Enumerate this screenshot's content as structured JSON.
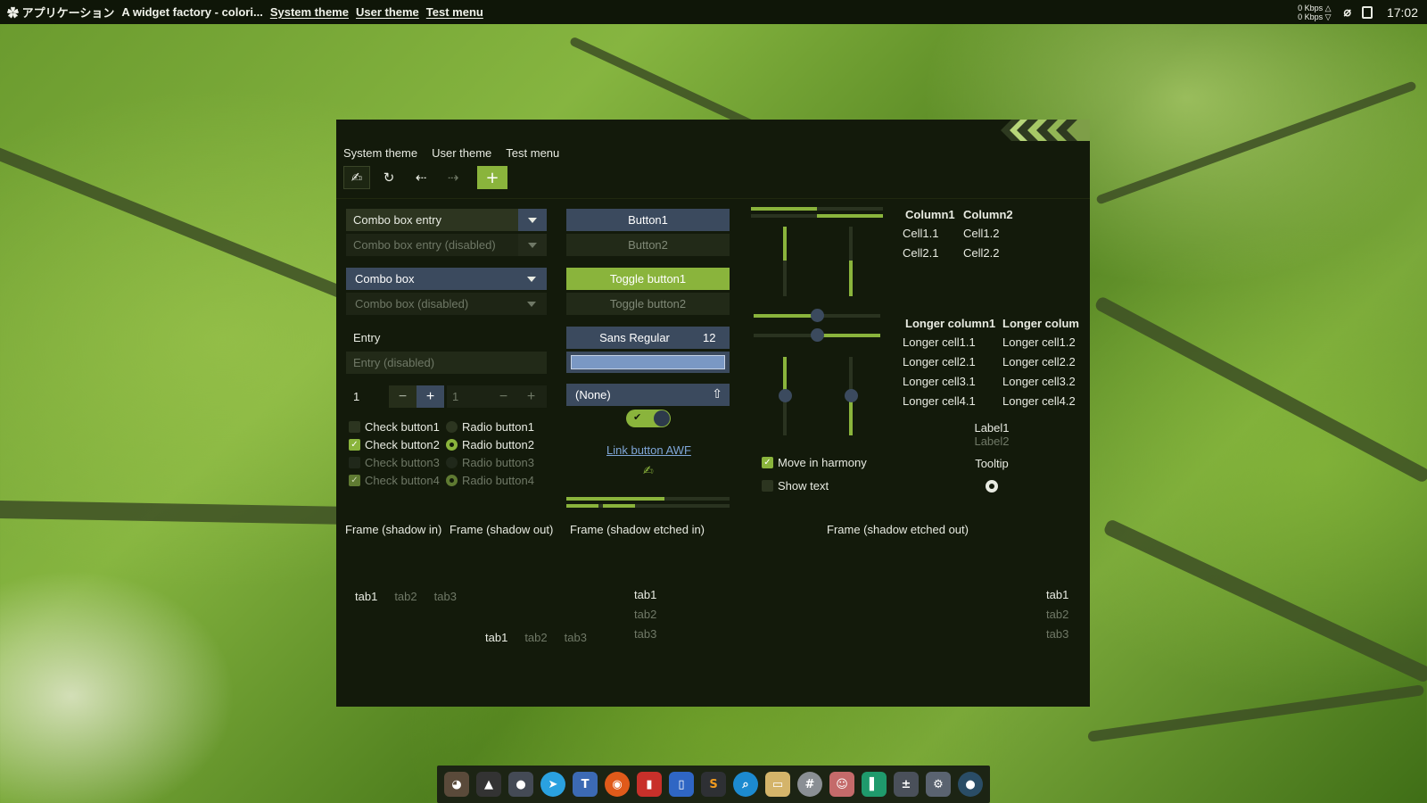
{
  "topbar": {
    "app_menu": "アプリケーション",
    "window_title": "A widget factory - colori...",
    "menu_system_theme": "System theme",
    "menu_user_theme": "User theme",
    "menu_test": "Test menu",
    "net_up": "0 Kbps △",
    "net_down": "0 Kbps ▽",
    "clock": "17:02"
  },
  "window": {
    "menu": [
      "System theme",
      "User theme",
      "Test menu"
    ],
    "toolbar_icons": [
      "gimp-icon",
      "refresh-icon",
      "back-icon",
      "forward-icon",
      "add-icon"
    ],
    "add_label": "+",
    "col1": {
      "combo_entry": "Combo box entry",
      "combo_entry_disabled": "Combo box entry (disabled)",
      "combo_box": "Combo box",
      "combo_box_disabled": "Combo box (disabled)",
      "entry": "Entry",
      "entry_disabled": "Entry (disabled)",
      "spin1_value": "1",
      "spin2_value": "1",
      "minus": "−",
      "plus": "+",
      "checks": [
        "Check button1",
        "Check button2",
        "Check button3",
        "Check button4"
      ],
      "radios": [
        "Radio button1",
        "Radio button2",
        "Radio button3",
        "Radio button4"
      ]
    },
    "col2": {
      "button1": "Button1",
      "button2": "Button2",
      "toggle1": "Toggle button1",
      "toggle2": "Toggle button2",
      "font_name": "Sans Regular",
      "font_size": "12",
      "file_none": "(None)",
      "link": "Link button AWF",
      "switch_on": true
    },
    "col3": {
      "progress_top_fraction": 0.5,
      "move_in_harmony": "Move in harmony",
      "show_text": "Show text"
    },
    "col4": {
      "tree1_headers": [
        "Column1",
        "Column2"
      ],
      "tree1_rows": [
        [
          "Cell1.1",
          "Cell1.2"
        ],
        [
          "Cell2.1",
          "Cell2.2"
        ]
      ],
      "tree2_headers": [
        "Longer column1",
        "Longer colum"
      ],
      "tree2_rows": [
        [
          "Longer cell1.1",
          "Longer cell1.2"
        ],
        [
          "Longer cell2.1",
          "Longer cell2.2"
        ],
        [
          "Longer cell3.1",
          "Longer cell3.2"
        ],
        [
          "Longer cell4.1",
          "Longer cell4.2"
        ]
      ],
      "label1": "Label1",
      "label2": "Label2",
      "tooltip": "Tooltip"
    },
    "frames": [
      "Frame (shadow in)",
      "Frame (shadow out)",
      "Frame (shadow etched in)",
      "Frame (shadow etched out)"
    ],
    "tabs": [
      "tab1",
      "tab2",
      "tab3"
    ]
  },
  "dock": {
    "apps": [
      "gimp",
      "inkscape",
      "palette",
      "telegram",
      "tex",
      "firefox",
      "archive",
      "notebook",
      "sublime",
      "search",
      "files",
      "hash",
      "anime",
      "book",
      "calculator",
      "settings",
      "record"
    ]
  },
  "colors": {
    "accent": "#8ab43c",
    "window_bg": "#131a0b",
    "button_bg": "#3b4a5e"
  }
}
